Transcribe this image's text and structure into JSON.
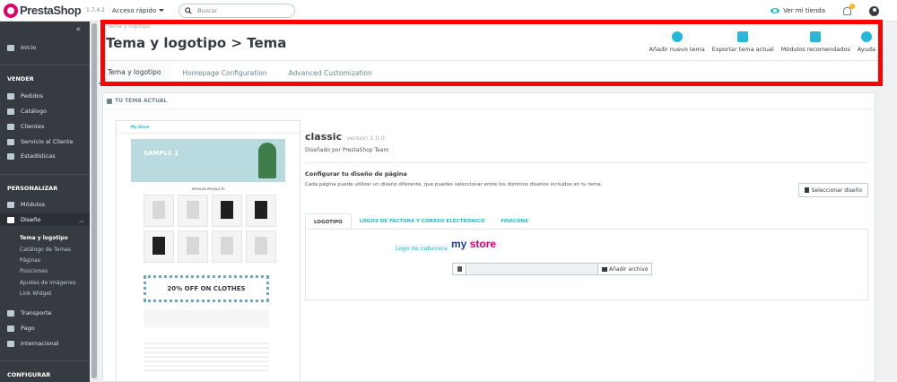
{
  "topbar": {
    "brand": "PrestaShop",
    "version": "1.7.4.2",
    "quick_access": "Acceso rápido",
    "search_placeholder": "Buscar",
    "store_link": "Ver mi tienda",
    "notification_count": "1"
  },
  "sidebar": {
    "collapse": "«",
    "home": "Inicio",
    "sections": {
      "sell": "VENDER",
      "customize": "PERSONALIZAR",
      "configure": "CONFIGURAR"
    },
    "sell_items": [
      "Pedidos",
      "Catálogo",
      "Clientes",
      "Servicio al Cliente",
      "Estadísticas"
    ],
    "customize_items": [
      "Módulos",
      "Diseño",
      "Transporte",
      "Pago",
      "Internacional"
    ],
    "design_subitems": [
      "Tema y logotipo",
      "Catálogo de Temas",
      "Páginas",
      "Posiciones",
      "Ajustes de imágenes",
      "Link Widget"
    ]
  },
  "header": {
    "breadcrumb": "Tema y logotipo",
    "title": "Tema y logotipo > Tema",
    "toolbar": [
      "Añadir nuevo tema",
      "Exportar tema actual",
      "Módulos recomendados",
      "Ayuda"
    ],
    "tabs": [
      "Tema y logotipo",
      "Homepage Configuration",
      "Advanced Customization"
    ]
  },
  "panel": {
    "heading": "TU TEMA ACTUAL",
    "theme_name": "classic",
    "theme_version": "version 1.0.0",
    "designer": "Diseñado por PrestaShop Team",
    "config_title": "Configurar tu diseño de página",
    "config_desc": "Cada página puede utilizar un diseño diferente, que puedes seleccionar entre los distintos diseños incluidos en tu tema.",
    "select_layout": "Seleccionar diseño",
    "logo_tabs": [
      "LOGOTIPO",
      "LOGOS DE FACTURA Y CORREO ELECTRÓNICO",
      "FAVICONS"
    ],
    "header_logo_label": "Logo de cabecera",
    "store_logo": "my store",
    "add_file": "Añadir archivo"
  },
  "preview": {
    "nav": "My Store",
    "hero": "SAMPLE 1",
    "section_title": "POPULAR PRODUCTS",
    "banner": "20% OFF ON CLOTHES"
  },
  "colors": {
    "accent": "#25b9d7",
    "sidebar": "#363a41",
    "highlight": "#ff0000",
    "brand_pink": "#df0067"
  }
}
